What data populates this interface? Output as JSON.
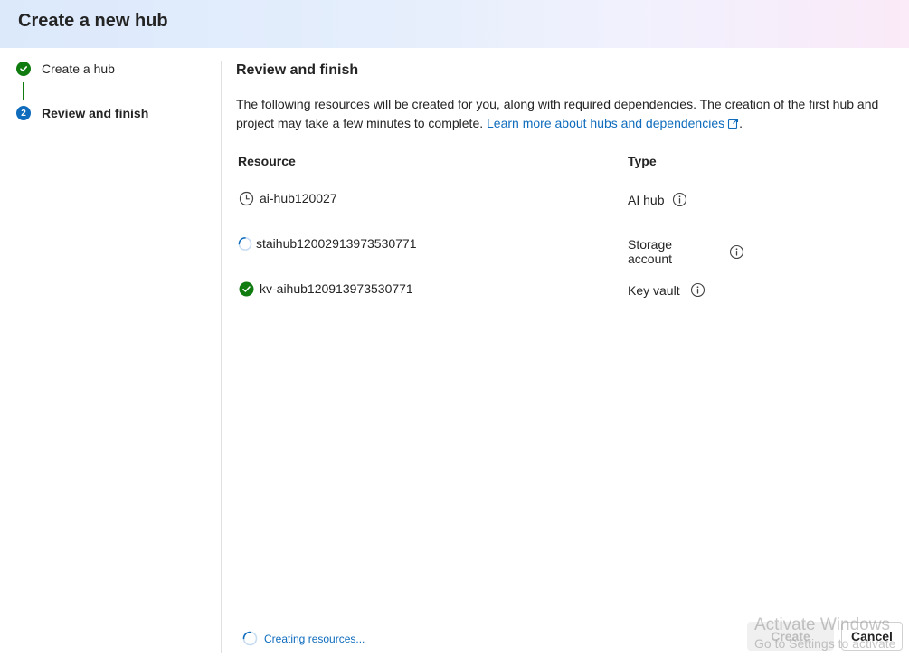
{
  "header": {
    "title": "Create a new hub"
  },
  "stepper": {
    "steps": [
      {
        "label": "Create a hub",
        "state": "completed",
        "icon": "checkmark-icon"
      },
      {
        "label": "Review and finish",
        "number": "2",
        "state": "current"
      }
    ]
  },
  "main": {
    "title": "Review and finish",
    "description": "The following resources will be created for you, along with required dependencies. The creation of the first hub and project may take a few minutes to complete.",
    "learn_more_link": "Learn more about hubs and dependencies",
    "description_end": ".",
    "columns": {
      "resource": "Resource",
      "type": "Type"
    },
    "rows": [
      {
        "resource": "ai-hub120027",
        "type": "AI hub",
        "status": "pending",
        "icon": "clock-icon"
      },
      {
        "resource": "staihub12002913973530771",
        "type": "Storage account",
        "status": "in-progress",
        "icon": "spinner-icon"
      },
      {
        "resource": "kv-aihub120913973530771",
        "type": "Key vault",
        "status": "completed",
        "icon": "checkmark-circle-icon"
      }
    ]
  },
  "footer": {
    "status_text": "Creating resources...",
    "create_label": "Create",
    "cancel_label": "Cancel"
  },
  "watermark": {
    "line1": "Activate Windows",
    "line2": "Go to Settings to activate"
  },
  "colors": {
    "accent": "#0f6cbd",
    "success": "#107c10",
    "text": "#242424"
  }
}
